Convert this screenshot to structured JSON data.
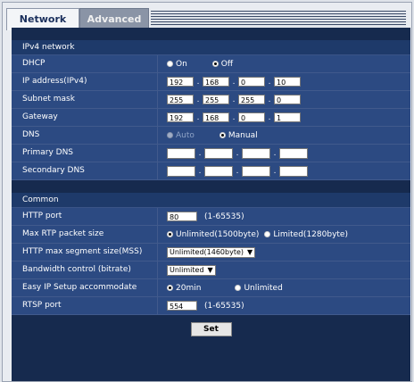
{
  "tabs": [
    {
      "label": "Network"
    },
    {
      "label": "Advanced"
    }
  ],
  "ipv4": {
    "heading": "IPv4 network",
    "dhcp": {
      "label": "DHCP",
      "opt_on": "On",
      "opt_off": "Off",
      "selected": "Off"
    },
    "ip": {
      "label": "IP address(IPv4)",
      "o1": "192",
      "o2": "168",
      "o3": "0",
      "o4": "10"
    },
    "subnet": {
      "label": "Subnet mask",
      "o1": "255",
      "o2": "255",
      "o3": "255",
      "o4": "0"
    },
    "gateway": {
      "label": "Gateway",
      "o1": "192",
      "o2": "168",
      "o3": "0",
      "o4": "1"
    },
    "dns": {
      "label": "DNS",
      "opt_auto": "Auto",
      "opt_manual": "Manual",
      "selected": "Manual"
    },
    "primary_dns": {
      "label": "Primary DNS"
    },
    "secondary_dns": {
      "label": "Secondary DNS"
    }
  },
  "common": {
    "heading": "Common",
    "http_port": {
      "label": "HTTP port",
      "value": "80",
      "hint": "(1-65535)"
    },
    "rtp": {
      "label": "Max RTP packet size",
      "opt_unlimited": "Unlimited(1500byte)",
      "opt_limited": "Limited(1280byte)",
      "selected": "Unlimited(1500byte)"
    },
    "mss": {
      "label": "HTTP max segment size(MSS)",
      "value": "Unlimited(1460byte)"
    },
    "bw": {
      "label": "Bandwidth control (bitrate)",
      "value": "Unlimited"
    },
    "easyip": {
      "label": "Easy IP Setup accommodate period",
      "opt_20": "20min",
      "opt_unl": "Unlimited",
      "selected": "20min"
    },
    "rtsp": {
      "label": "RTSP port",
      "value": "554",
      "hint": "(1-65535)"
    }
  },
  "set_label": "Set"
}
